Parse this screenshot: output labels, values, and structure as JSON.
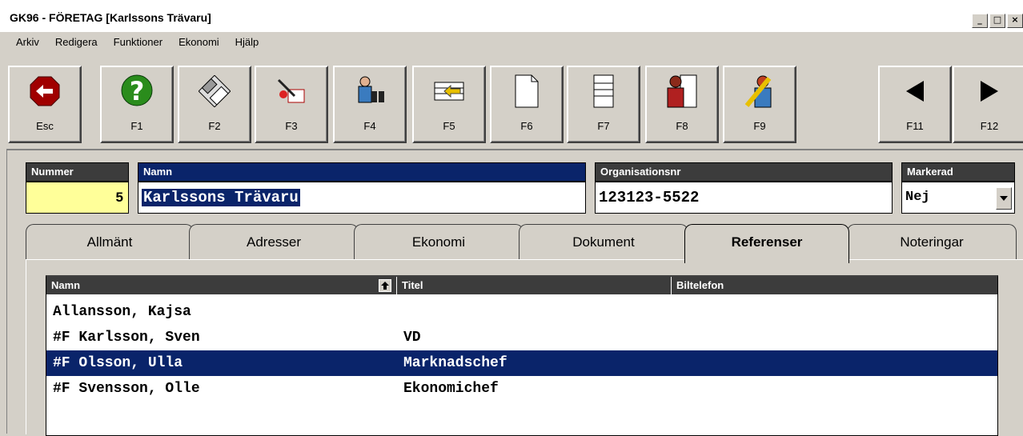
{
  "window": {
    "title": "GK96 - FÖRETAG [Karlssons Trävaru]",
    "controls": [
      "_",
      "□",
      "×"
    ]
  },
  "menu": [
    "Arkiv",
    "Redigera",
    "Funktioner",
    "Ekonomi",
    "Hjälp"
  ],
  "toolbar": [
    {
      "label": "Esc",
      "icon": "stop-back-icon"
    },
    {
      "label": "F1",
      "icon": "help-icon"
    },
    {
      "label": "F2",
      "icon": "diskette-icon"
    },
    {
      "label": "F3",
      "icon": "write-icon"
    },
    {
      "label": "F4",
      "icon": "search-binoculars-icon"
    },
    {
      "label": "F5",
      "icon": "list-arrow-icon"
    },
    {
      "label": "F6",
      "icon": "blank-page-icon"
    },
    {
      "label": "F7",
      "icon": "printer-list-icon"
    },
    {
      "label": "F8",
      "icon": "person-list-icon"
    },
    {
      "label": "F9",
      "icon": "person-pencil-icon"
    },
    {
      "label": "F11",
      "icon": "prev-arrow-icon"
    },
    {
      "label": "F12",
      "icon": "next-arrow-icon"
    }
  ],
  "fields": {
    "nummer": {
      "label": "Nummer",
      "value": "5"
    },
    "namn": {
      "label": "Namn",
      "value": "Karlssons Trävaru"
    },
    "orgnr": {
      "label": "Organisationsnr",
      "value": "123123-5522"
    },
    "markerad": {
      "label": "Markerad",
      "value": "Nej"
    }
  },
  "tabs": [
    {
      "label": "Allmänt"
    },
    {
      "label": "Adresser"
    },
    {
      "label": "Ekonomi"
    },
    {
      "label": "Dokument"
    },
    {
      "label": "Referenser",
      "active": true
    },
    {
      "label": "Noteringar"
    }
  ],
  "grid": {
    "columns": [
      "Namn",
      "Titel",
      "Biltelefon"
    ],
    "sort_icon": "sort-up-icon",
    "rows": [
      {
        "namn": "Allansson, Kajsa",
        "titel": ""
      },
      {
        "namn": "#F Karlsson, Sven",
        "titel": "VD"
      },
      {
        "namn": "#F Olsson, Ulla",
        "titel": "Marknadschef",
        "selected": true
      },
      {
        "namn": "#F Svensson, Olle",
        "titel": "Ekonomichef"
      }
    ]
  },
  "colors": {
    "selection": "#0a246a",
    "header": "#3c3c3c",
    "nummer_bg": "#ffff99",
    "face": "#d4d0c8"
  }
}
